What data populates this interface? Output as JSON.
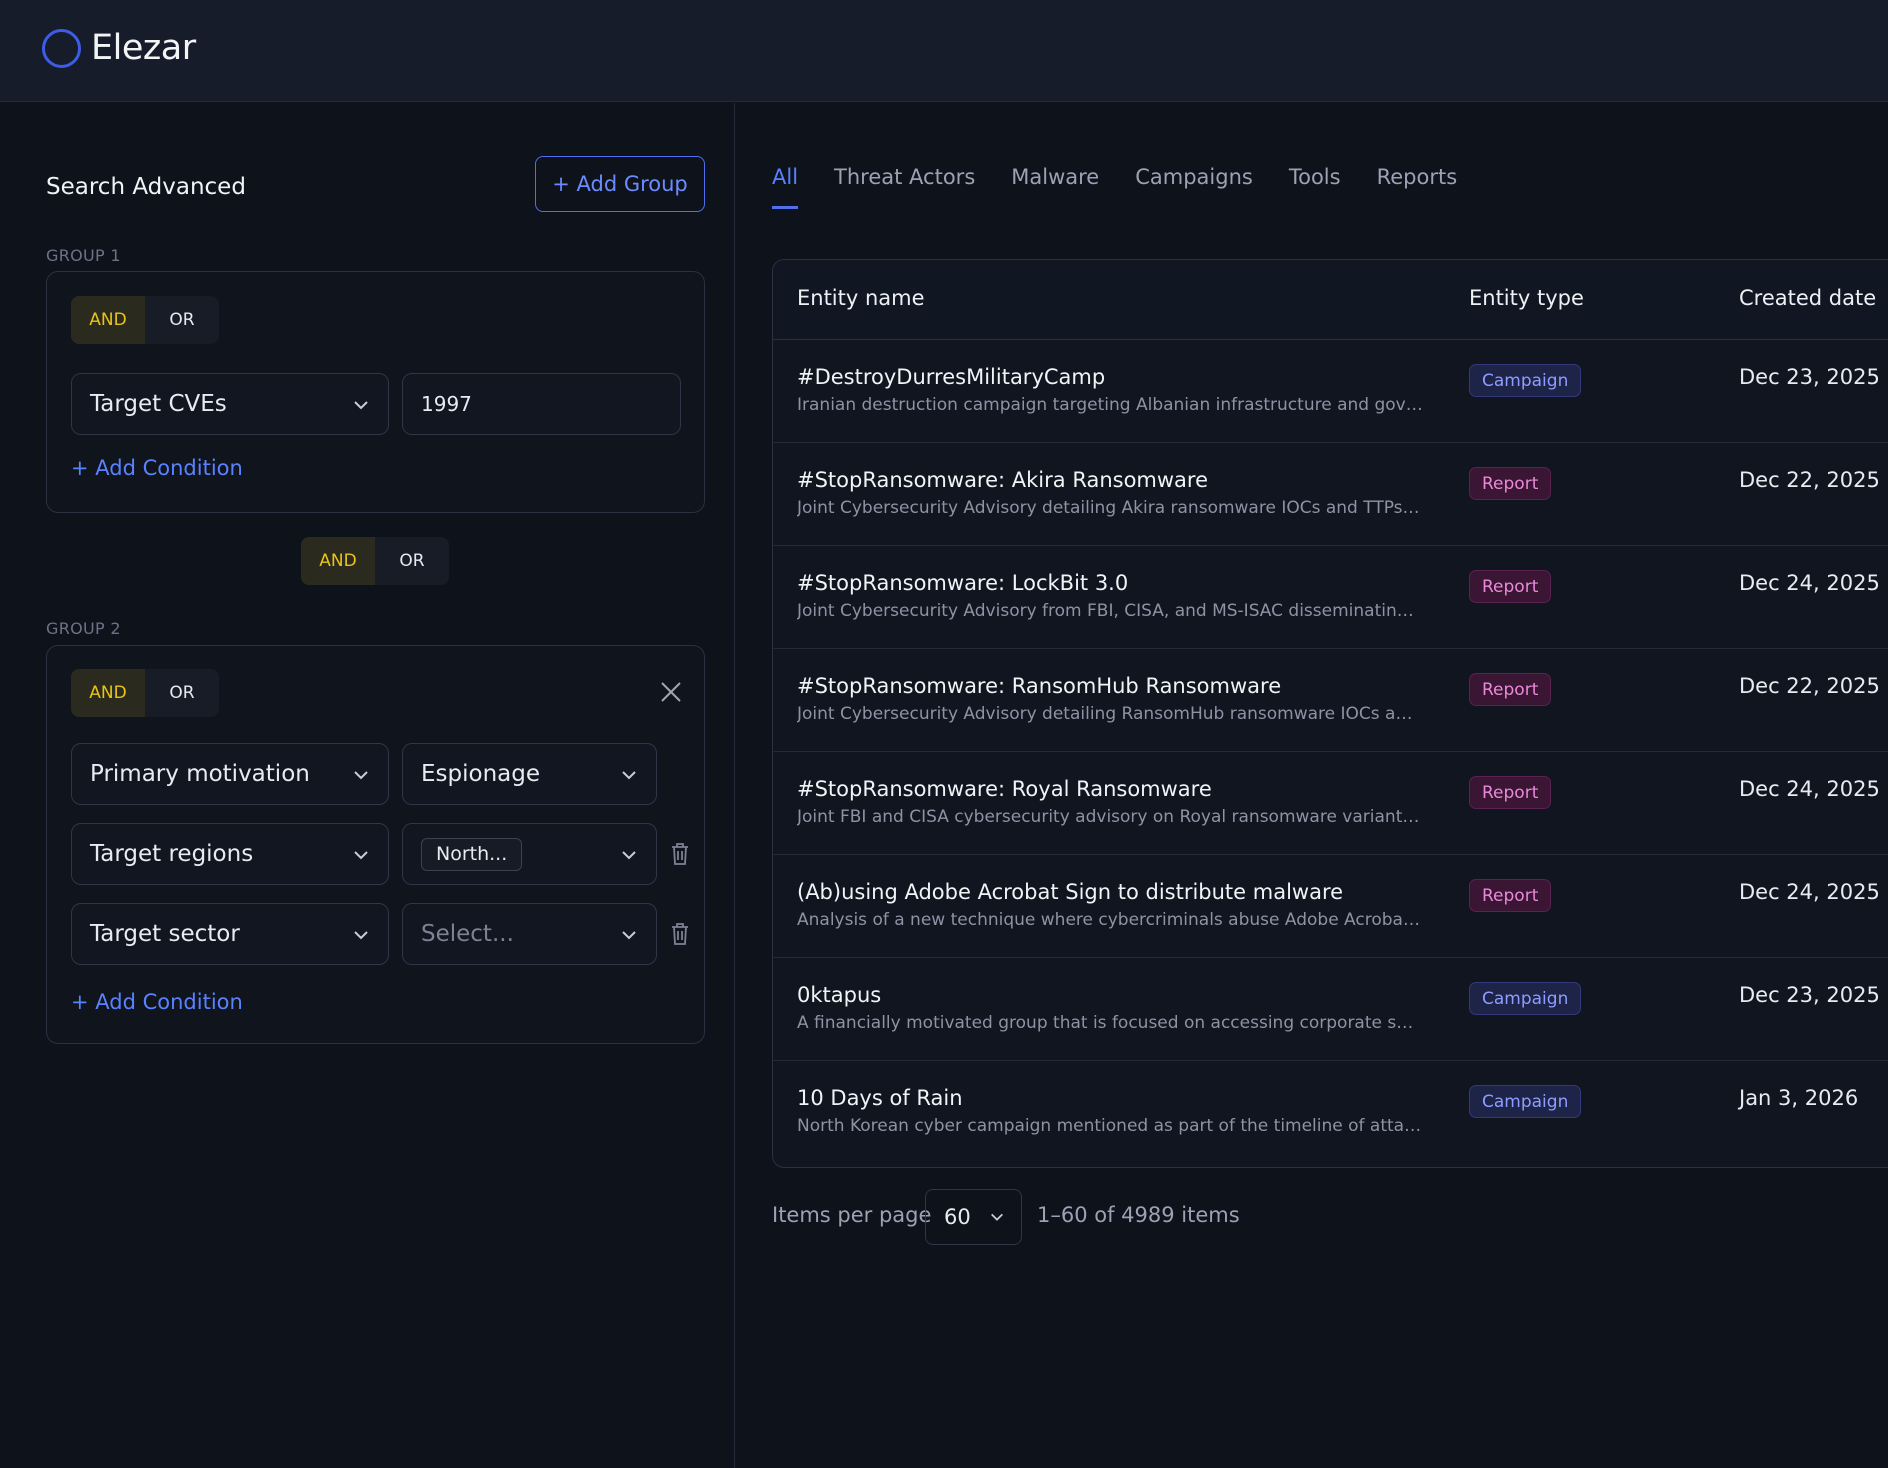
{
  "app": {
    "name": "Elezar"
  },
  "search": {
    "title": "Search Advanced",
    "add_group_label": "+ Add Group",
    "add_condition_label": "+ Add Condition",
    "group1": {
      "label": "GROUP 1",
      "toggle": {
        "and": "AND",
        "or": "OR",
        "selected": "AND"
      },
      "conditions": [
        {
          "field": "Target CVEs",
          "value": "1997"
        }
      ]
    },
    "between_toggle": {
      "and": "AND",
      "or": "OR",
      "selected": "AND"
    },
    "group2": {
      "label": "GROUP 2",
      "toggle": {
        "and": "AND",
        "or": "OR",
        "selected": "AND"
      },
      "conditions": [
        {
          "field": "Primary motivation",
          "value": "Espionage"
        },
        {
          "field": "Target regions",
          "chip": "North..."
        },
        {
          "field": "Target sector",
          "placeholder": "Select..."
        }
      ]
    }
  },
  "tabs": [
    "All",
    "Threat Actors",
    "Malware",
    "Campaigns",
    "Tools",
    "Reports"
  ],
  "active_tab": "All",
  "table": {
    "columns": {
      "name": "Entity name",
      "type": "Entity type",
      "date": "Created date"
    },
    "rows": [
      {
        "name": "#DestroyDurresMilitaryCamp",
        "desc": "Iranian destruction campaign targeting Albanian infrastructure and governme...",
        "type": "Campaign",
        "date": "Dec 23, 2025"
      },
      {
        "name": "#StopRansomware: Akira Ransomware",
        "desc": "Joint Cybersecurity Advisory detailing Akira ransomware IOCs and TTPs identif...",
        "type": "Report",
        "date": "Dec 22, 2025"
      },
      {
        "name": "#StopRansomware: LockBit 3.0",
        "desc": "Joint Cybersecurity Advisory from FBI, CISA, and MS-ISAC disseminating know...",
        "type": "Report",
        "date": "Dec 24, 2025"
      },
      {
        "name": "#StopRansomware: RansomHub Ransomware",
        "desc": "Joint Cybersecurity Advisory detailing RansomHub ransomware IOCs and TTP...",
        "type": "Report",
        "date": "Dec 22, 2025"
      },
      {
        "name": "#StopRansomware: Royal Ransomware",
        "desc": "Joint FBI and CISA cybersecurity advisory on Royal ransomware variant, includi...",
        "type": "Report",
        "date": "Dec 24, 2025"
      },
      {
        "name": "(Ab)using Adobe Acrobat Sign to distribute malware",
        "desc": "Analysis of a new technique where cybercriminals abuse Adobe Acrobat Sign ...",
        "type": "Report",
        "date": "Dec 24, 2025"
      },
      {
        "name": "0ktapus",
        "desc": "A financially motivated group that is focused on accessing corporate services, ...",
        "type": "Campaign",
        "date": "Dec 23, 2025"
      },
      {
        "name": "10 Days of Rain",
        "desc": "North Korean cyber campaign mentioned as part of the timeline of attacks att...",
        "type": "Campaign",
        "date": "Jan 3, 2026"
      }
    ]
  },
  "pagination": {
    "label": "Items per page",
    "per_page": "60",
    "summary": "1–60 of 4989 items"
  },
  "colors": {
    "accent": "#4f6ff0",
    "toggle_active": "#e9c419",
    "campaign_badge": "#8e9dff",
    "report_badge": "#e98ad8",
    "background": "#0e121b"
  }
}
